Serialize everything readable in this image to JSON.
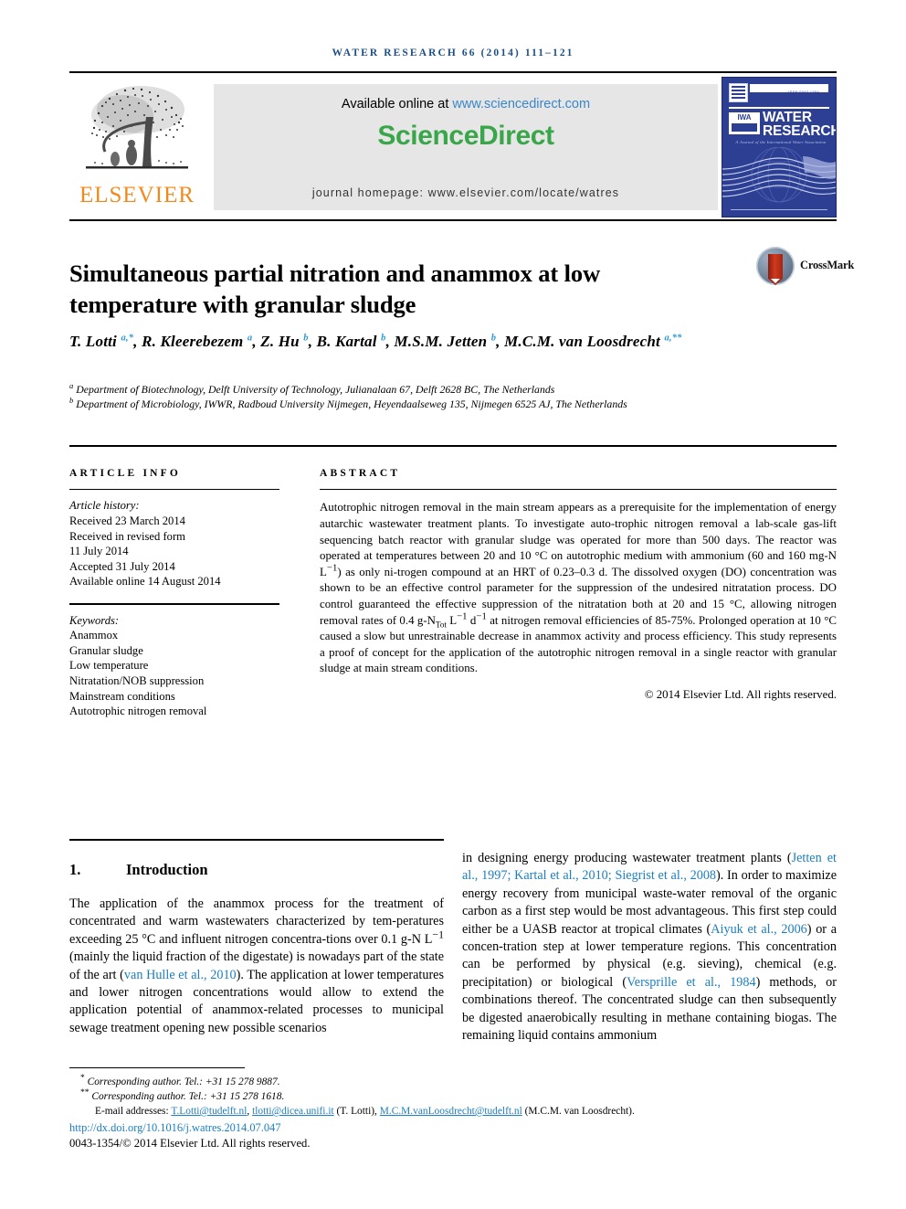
{
  "running_head": "water research 66 (2014) 111–121",
  "masthead": {
    "publisher_logo_name": "elsevier-tree-logo",
    "publisher_name": "ELSEVIER",
    "available_online_prefix": "Available online at ",
    "available_online_url": "www.sciencedirect.com",
    "sciencedirect_logo": "ScienceDirect",
    "journal_homepage": "journal homepage: www.elsevier.com/locate/watres",
    "cover": {
      "title_line1": "WATER",
      "title_line2": "RESEARCH",
      "society_badge": "IWA",
      "subtitle": "A Journal of the International Water Association",
      "issn_tag": "ISSN 0043-1354"
    }
  },
  "article": {
    "title": "Simultaneous partial nitration and anammox at low temperature with granular sludge",
    "crossmark_label": "CrossMark",
    "authors_html": "T. Lotti <sup>a,*</sup>, R. Kleerebezem <sup>a</sup>, Z. Hu <sup>b</sup>, B. Kartal <sup>b</sup>, M.S.M. Jetten <sup>b</sup>, M.C.M. van Loosdrecht <sup>a,**</sup>",
    "affiliations": [
      "a Department of Biotechnology, Delft University of Technology, Julianalaan 67, Delft 2628 BC, The Netherlands",
      "b Department of Microbiology, IWWR, Radboud University Nijmegen, Heyendaalseweg 135, Nijmegen 6525 AJ, The Netherlands"
    ]
  },
  "article_info": {
    "heading": "ARTICLE INFO",
    "history_label": "Article history:",
    "history": [
      "Received 23 March 2014",
      "Received in revised form",
      "11 July 2014",
      "Accepted 31 July 2014",
      "Available online 14 August 2014"
    ],
    "keywords_label": "Keywords:",
    "keywords": [
      "Anammox",
      "Granular sludge",
      "Low temperature",
      "Nitratation/NOB suppression",
      "Mainstream conditions",
      "Autotrophic nitrogen removal"
    ]
  },
  "abstract": {
    "heading": "ABSTRACT",
    "copyright": "© 2014 Elsevier Ltd. All rights reserved."
  },
  "introduction": {
    "number": "1.",
    "heading": "Introduction"
  },
  "footnotes": {
    "corresponding1_marker": "*",
    "corresponding1": "Corresponding author. Tel.: +31 15 278 9887.",
    "corresponding2_marker": "**",
    "corresponding2": "Corresponding author. Tel.: +31 15 278 1618.",
    "email_label": "E-mail addresses:",
    "emails": [
      {
        "address": "T.Lotti@tudelft.nl",
        "sep": ", "
      },
      {
        "address": "tlotti@dicea.unifi.it",
        "sep": " (T. Lotti), "
      },
      {
        "address": "M.C.M.vanLoosdrecht@tudelft.nl",
        "sep": " (M.C.M. van Loosdrecht)."
      }
    ],
    "doi": "http://dx.doi.org/10.1016/j.watres.2014.07.047",
    "issn_copyright": "0043-1354/© 2014 Elsevier Ltd. All rights reserved."
  },
  "colors": {
    "journal_blue": "#1b4f86",
    "link_blue": "#1a7fc1",
    "sciencedirect_green": "#3aa64a",
    "elsevier_orange": "#f08a1e",
    "cover_blue": "#2c3f93",
    "superscript_blue": "#2e9bd6"
  }
}
